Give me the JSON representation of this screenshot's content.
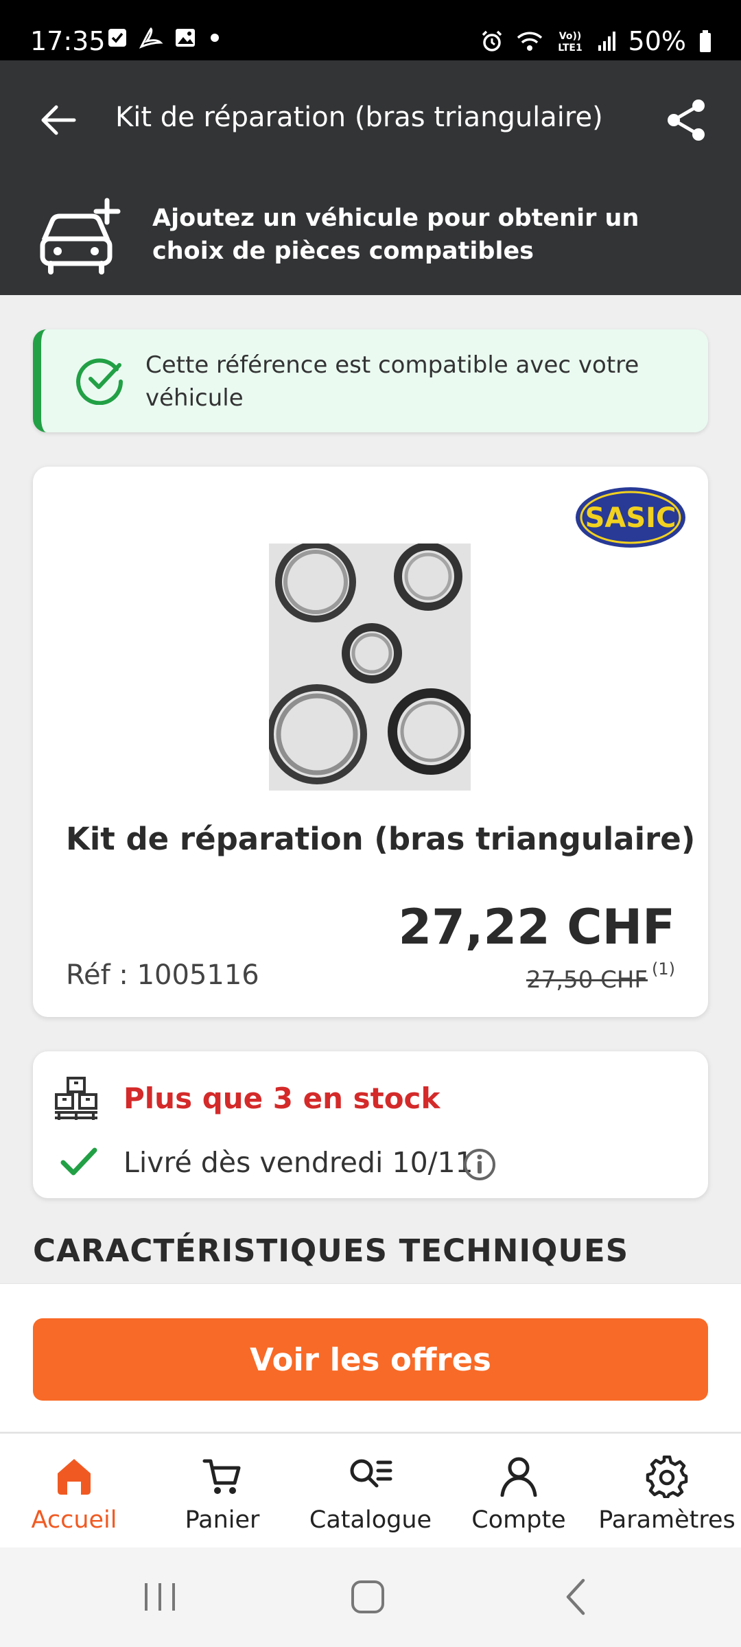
{
  "status_bar": {
    "time": "17:35",
    "battery": "50%",
    "left_icons": [
      "checkbox-icon",
      "pdf-icon",
      "gallery-icon",
      "dot-icon"
    ],
    "right_icons": [
      "alarm-icon",
      "wifi-icon",
      "volte-icon",
      "signal-icon",
      "battery-icon"
    ],
    "volte_line1": "Vo))",
    "volte_line2": "LTE1"
  },
  "app_bar": {
    "title": "Kit de réparation (bras triangulaire)"
  },
  "vehicle_banner": {
    "text": "Ajoutez un véhicule pour obtenir un choix de pièces compatibles"
  },
  "compatibility": {
    "text": "Cette référence est compatible avec votre véhicule",
    "color": "#22a045"
  },
  "product": {
    "brand": "SASIC",
    "name": "Kit de réparation (bras triangulaire)",
    "reference": "Réf : 1005116",
    "price": "27,22 CHF",
    "old_price": "27,50 CHF",
    "price_note": "(1)"
  },
  "stock": {
    "stock_text": "Plus que 3 en stock",
    "delivery_text": "Livré dès vendredi 10/11",
    "stock_color": "#d42a2a"
  },
  "section": {
    "heading": "CARACTÉRISTIQUES TECHNIQUES"
  },
  "cta": {
    "label": "Voir les offres",
    "color": "#f86a27"
  },
  "bottom_nav": {
    "items": [
      {
        "label": "Accueil",
        "icon": "home-icon",
        "active": true
      },
      {
        "label": "Panier",
        "icon": "cart-icon",
        "active": false
      },
      {
        "label": "Catalogue",
        "icon": "catalog-search-icon",
        "active": false
      },
      {
        "label": "Compte",
        "icon": "account-icon",
        "active": false
      },
      {
        "label": "Paramètres",
        "icon": "gear-icon",
        "active": false
      }
    ],
    "active_color": "#f05a22"
  }
}
